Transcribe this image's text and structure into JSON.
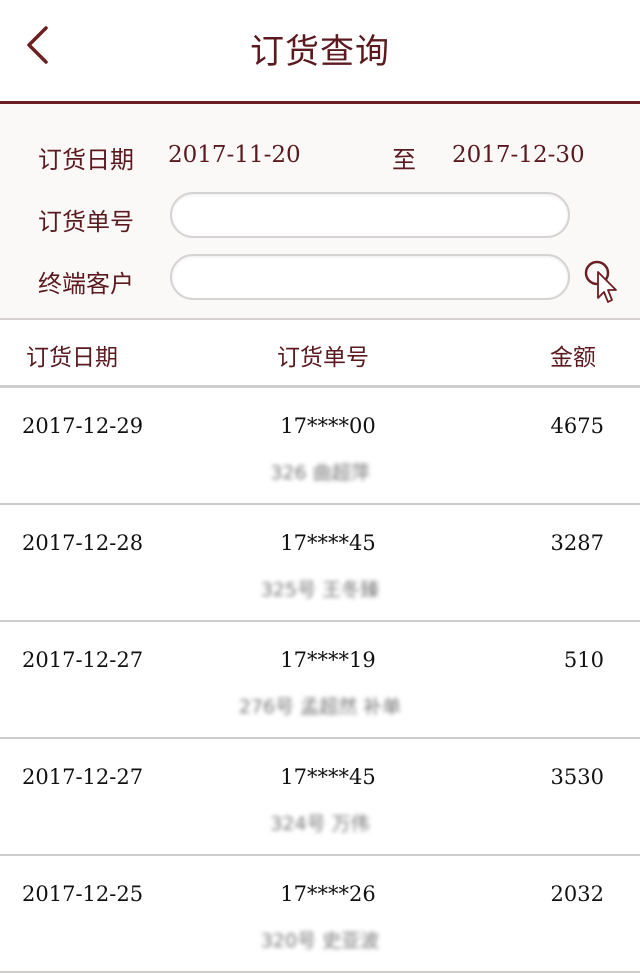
{
  "header": {
    "title": "订货查询",
    "back_icon": "chevron-left-icon"
  },
  "filter": {
    "date_label": "订货日期",
    "date_from": "2017-11-20",
    "date_to_label": "至",
    "date_to": "2017-12-30",
    "order_no_label": "订货单号",
    "order_no_value": "",
    "customer_label": "终端客户",
    "customer_value": "",
    "search_icon": "search-icon"
  },
  "table": {
    "headers": {
      "date": "订货日期",
      "order_no": "订货单号",
      "amount": "金额"
    },
    "rows": [
      {
        "date": "2017-12-29",
        "order_no": "17****00",
        "amount": "4675",
        "customer": "326 曲超萍"
      },
      {
        "date": "2017-12-28",
        "order_no": "17****45",
        "amount": "3287",
        "customer": "325号 王冬臻"
      },
      {
        "date": "2017-12-27",
        "order_no": "17****19",
        "amount": "510",
        "customer": "276号 孟超然 补单"
      },
      {
        "date": "2017-12-27",
        "order_no": "17****45",
        "amount": "3530",
        "customer": "324号 万伟"
      },
      {
        "date": "2017-12-25",
        "order_no": "17****26",
        "amount": "2032",
        "customer": "320号 史亚波"
      }
    ]
  },
  "colors": {
    "accent": "#6b1f22",
    "text": "#5a1a1f",
    "divider": "#cfcccc"
  }
}
